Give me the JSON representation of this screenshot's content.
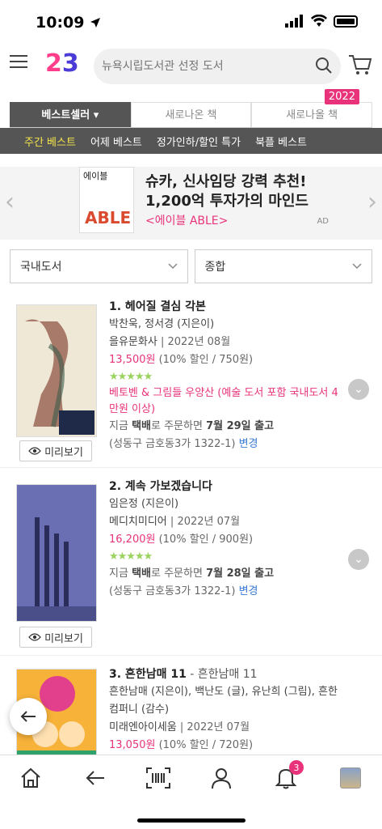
{
  "status_bar": {
    "time": "10:09"
  },
  "header": {
    "logo_digits": [
      "2",
      "3"
    ],
    "search_placeholder": "뉴욕시립도서관 선정 도서"
  },
  "tabs": [
    {
      "label": "베스트셀러 ▾",
      "active": true
    },
    {
      "label": "새로나온 책",
      "active": false
    },
    {
      "label": "새로나올 책",
      "active": false
    }
  ],
  "tabs_badge": "2022",
  "subnav": [
    {
      "label": "주간 베스트",
      "active": true
    },
    {
      "label": "어제 베스트",
      "active": false
    },
    {
      "label": "정가인하/할인 특가",
      "active": false
    },
    {
      "label": "북플 베스트",
      "active": false
    }
  ],
  "ad": {
    "book_title_small": "에이블",
    "book_title_big": "ABLE",
    "line1": "슈카, 신사임당 강력 추천!",
    "line2": "1,200억 투자가의 마인드",
    "line3": "<에이블 ABLE>",
    "label": "AD"
  },
  "filters": [
    {
      "value": "국내도서"
    },
    {
      "value": "종합"
    }
  ],
  "books": [
    {
      "rank_title": "1. 헤어질 결심 각본",
      "subtitle": "",
      "authors": "박찬욱, 정서경 (지은이)",
      "publisher": "을유문화사",
      "date": "2022년 08월",
      "price": "13,500원",
      "discount": "(10% 할인 / 750원)",
      "stars": "★★★★★",
      "promo": "베토벤 & 그림들 우양산 (예술 도서 포함 국내도서 4만원 이상)",
      "delivery_prefix": "지금 ",
      "delivery_method": "택배",
      "delivery_mid": "로 주문하면 ",
      "delivery_date": "7월 29일 출고",
      "address": "(성동구 금호동3가 1322-1)",
      "change_link": "변경",
      "preview_label": "미리보기"
    },
    {
      "rank_title": "2. 계속 가보겠습니다",
      "subtitle": "",
      "authors": "임은정 (지은이)",
      "publisher": "메디치미디어",
      "date": "2022년 07월",
      "price": "16,200원",
      "discount": "(10% 할인 / 900원)",
      "stars": "★★★★★",
      "promo": "",
      "delivery_prefix": "지금 ",
      "delivery_method": "택배",
      "delivery_mid": "로 주문하면 ",
      "delivery_date": "7월 28일 출고",
      "address": "(성동구 금호동3가 1322-1)",
      "change_link": "변경",
      "preview_label": "미리보기"
    },
    {
      "rank_title": "3. 흔한남매 11",
      "subtitle": " - 흔한남매 11",
      "authors": "흔한남매 (지은이), 백난도 (글), 유난희 (그림), 흔한컴퍼니 (감수)",
      "publisher": "미래엔아이세움",
      "date": "2022년 07월",
      "price": "13,050원",
      "discount": "(10% 할인 / 720원)"
    }
  ],
  "bottom_nav": {
    "notification_count": "3"
  }
}
